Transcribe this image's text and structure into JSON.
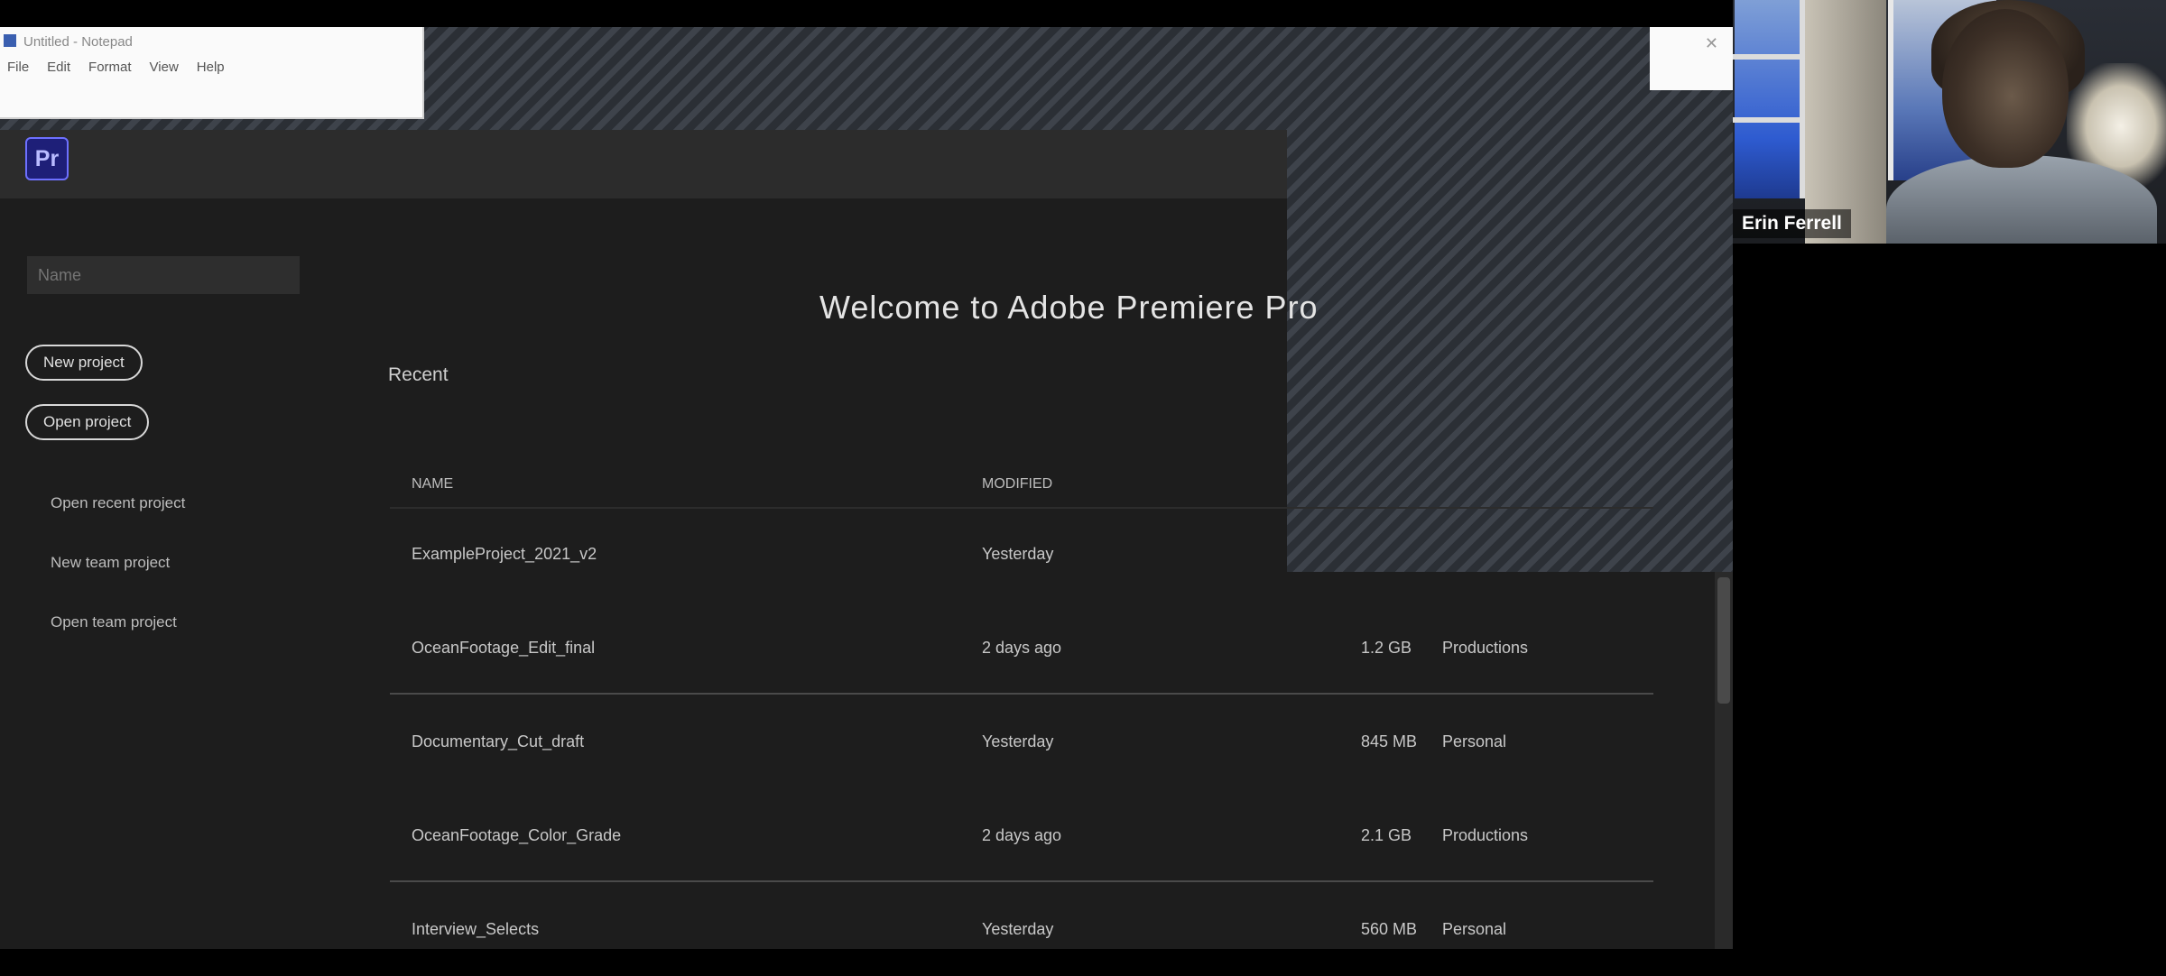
{
  "mini_window": {
    "title": "Untitled - Notepad",
    "menu": [
      "File",
      "Edit",
      "Format",
      "View",
      "Help"
    ]
  },
  "app": {
    "logo_text": "Pr",
    "search": {
      "value": "",
      "placeholder": "Name"
    },
    "sidebar": {
      "buttons": [
        "New project",
        "Open project"
      ],
      "links": [
        "Open recent project",
        "New team project",
        "Open team project"
      ]
    },
    "main": {
      "title": "Welcome to Adobe Premiere Pro",
      "section_label": "Recent",
      "columns": {
        "name": "NAME",
        "type": "MODIFIED"
      },
      "rows": [
        {
          "name": "ExampleProject_2021_v2",
          "type": "Yesterday",
          "size": "",
          "status": ""
        },
        {
          "name": "OceanFootage_Edit_final",
          "type": "2 days ago",
          "size": "1.2 GB",
          "status": "Productions"
        },
        {
          "name": "Documentary_Cut_draft",
          "type": "Yesterday",
          "size": "845 MB",
          "status": "Personal"
        },
        {
          "name": "OceanFootage_Color_Grade",
          "type": "2 days ago",
          "size": "2.1 GB",
          "status": "Productions"
        },
        {
          "name": "Interview_Selects",
          "type": "Yesterday",
          "size": "560 MB",
          "status": "Personal"
        }
      ]
    }
  },
  "participant": {
    "name": "Erin Ferrell"
  }
}
